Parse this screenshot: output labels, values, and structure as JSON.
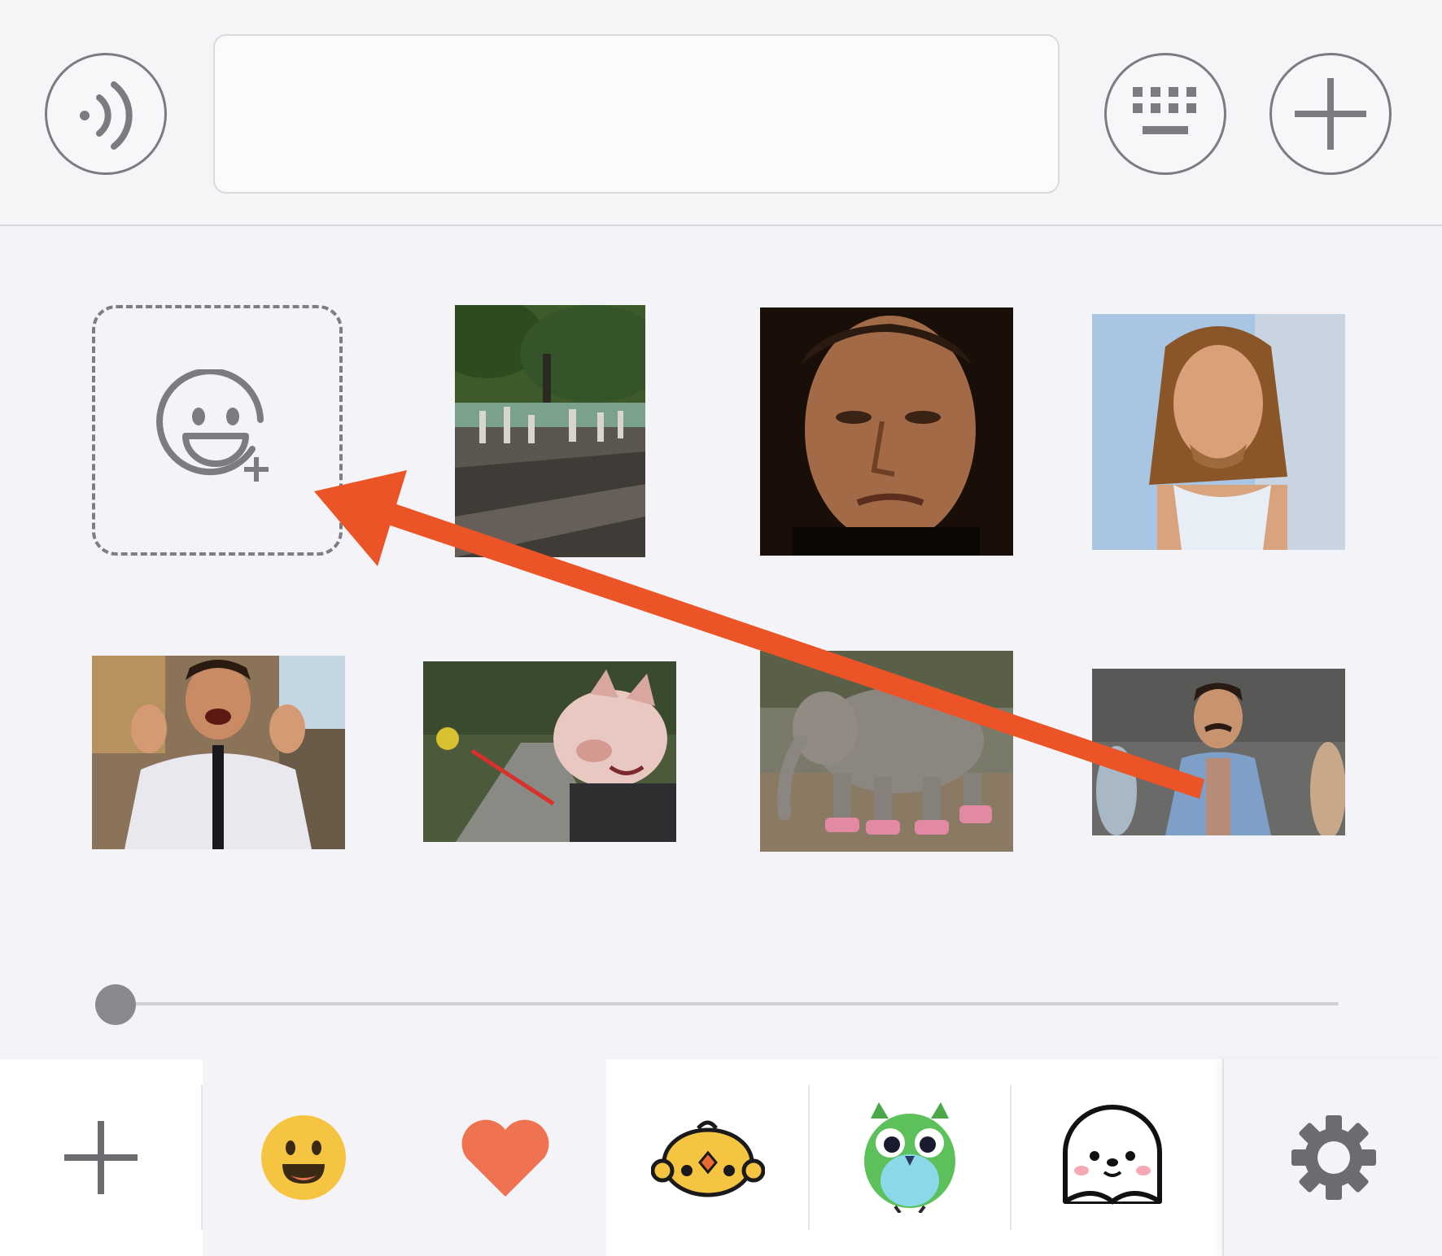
{
  "input_bar": {
    "voice_icon": "voice-icon",
    "message_value": "",
    "keyboard_icon": "keyboard-icon",
    "more_icon": "plus-icon"
  },
  "sticker_panel": {
    "add_sticker_icon": "add-sticker-icon",
    "stickers": [
      {
        "name": "street-crowd-gif"
      },
      {
        "name": "man-squinting-gif"
      },
      {
        "name": "long-haired-man-gif"
      },
      {
        "name": "man-clapping-gif"
      },
      {
        "name": "pig-on-leash-gif"
      },
      {
        "name": "elephant-sneakers-gif"
      },
      {
        "name": "mustache-man-gif"
      }
    ],
    "page_indicator": {
      "position": 0
    }
  },
  "annotation": {
    "arrow_color": "#ea5427"
  },
  "tab_bar": {
    "tabs": [
      {
        "name": "add-pack",
        "icon": "plus-icon"
      },
      {
        "name": "emoji",
        "icon": "smiley-icon",
        "selected": true
      },
      {
        "name": "favorites",
        "icon": "heart-icon",
        "selected": true
      },
      {
        "name": "chick-pack",
        "icon": "chick-icon"
      },
      {
        "name": "owl-pack",
        "icon": "owl-icon"
      },
      {
        "name": "seal-pack",
        "icon": "seal-icon"
      }
    ],
    "settings_icon": "gear-icon"
  },
  "colors": {
    "background": "#f4f3f7",
    "icon_gray": "#7c7c80",
    "arrow": "#ea5427",
    "emoji_yellow": "#f5c542",
    "heart": "#ef7350",
    "owl_green": "#5cc15a"
  }
}
